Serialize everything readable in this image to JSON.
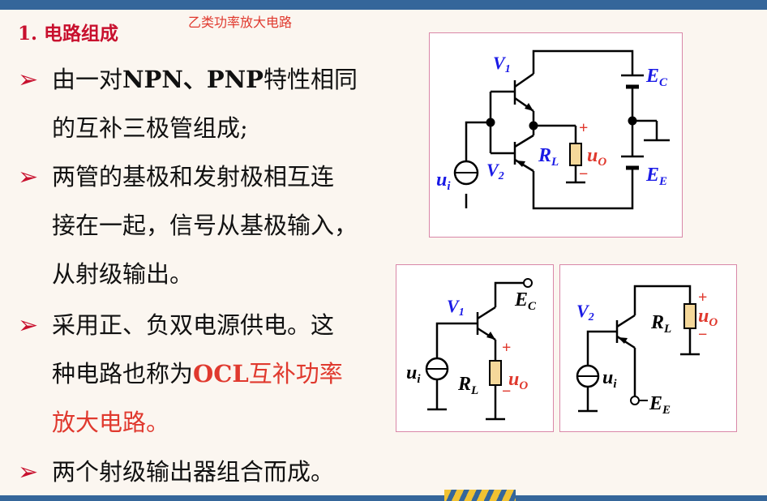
{
  "heading": "1. 电路组成",
  "subtitle": "乙类功率放大电路",
  "bullets": [
    {
      "marker": "➢",
      "line1_a": "由一对",
      "line1_b": "NPN、PNP",
      "line1_c": "特性相同",
      "line2": "的互补三极管组成;"
    },
    {
      "marker": "➢",
      "line1": "两管的基极和发射极相互连",
      "line2": "接在一起，信号从基极输入，",
      "line3": "从射级输出。"
    },
    {
      "marker": "➢",
      "line1": "采用正、负双电源供电。这",
      "line2_a": "种电路也称为",
      "line2_b": "OCL",
      "line2_c": "互补功率",
      "line3": "放大电路。"
    },
    {
      "marker": "➢",
      "line1": "两个射级输出器组合而成。"
    }
  ],
  "diagram_main": {
    "v1": "V",
    "v1_sub": "1",
    "v2": "V",
    "v2_sub": "2",
    "ec": "E",
    "ec_sub": "C",
    "ee": "E",
    "ee_sub": "E",
    "rl": "R",
    "rl_sub": "L",
    "uo": "u",
    "uo_sub": "O",
    "ui": "u",
    "ui_sub": "i",
    "plus": "+",
    "minus": "−"
  },
  "diagram_left": {
    "v1": "V",
    "v1_sub": "1",
    "ec": "E",
    "ec_sub": "C",
    "rl": "R",
    "rl_sub": "L",
    "uo": "u",
    "uo_sub": "O",
    "ui": "u",
    "ui_sub": "i",
    "plus": "+",
    "minus": "−"
  },
  "diagram_right": {
    "v2": "V",
    "v2_sub": "2",
    "ee": "E",
    "ee_sub": "E",
    "rl": "R",
    "rl_sub": "L",
    "uo": "u",
    "uo_sub": "O",
    "ui": "u",
    "ui_sub": "i",
    "plus": "+",
    "minus": "−"
  },
  "colors": {
    "accent_red": "#e0392e",
    "heading_red": "#c8102e",
    "label_blue": "#1a1ae6",
    "bar_blue": "#35669a",
    "frame_pink": "#d987a8"
  }
}
